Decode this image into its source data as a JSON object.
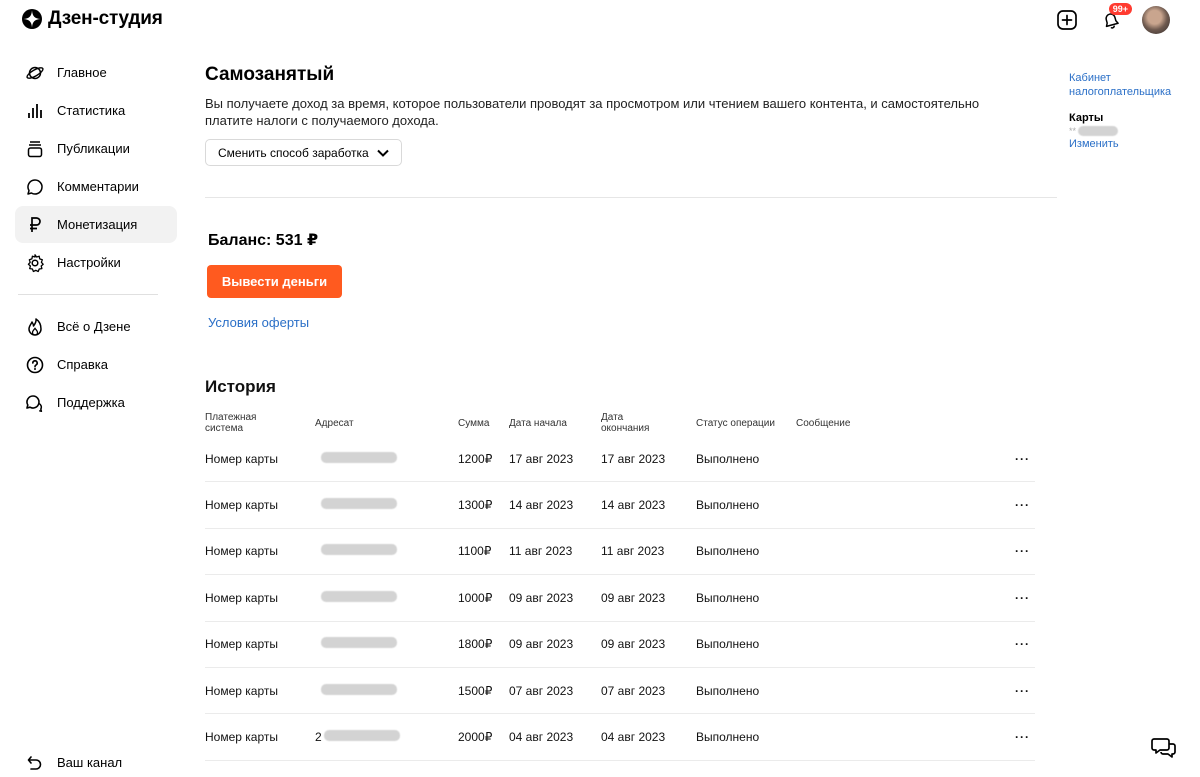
{
  "app": {
    "title": "Дзен-студия"
  },
  "header": {
    "notifications_badge": "99+"
  },
  "sidebar": {
    "items": [
      {
        "label": "Главное",
        "icon": "planet-icon"
      },
      {
        "label": "Статистика",
        "icon": "bar-chart-icon"
      },
      {
        "label": "Публикации",
        "icon": "publications-icon"
      },
      {
        "label": "Комментарии",
        "icon": "comment-icon"
      },
      {
        "label": "Монетизация",
        "icon": "ruble-icon",
        "active": true
      },
      {
        "label": "Настройки",
        "icon": "gear-icon"
      }
    ],
    "secondary": [
      {
        "label": "Всё о Дзене",
        "icon": "flame-icon"
      },
      {
        "label": "Справка",
        "icon": "help-icon"
      },
      {
        "label": "Поддержка",
        "icon": "support-icon"
      }
    ],
    "bottom": {
      "label": "Ваш канал",
      "icon": "back-arrow-icon"
    }
  },
  "main": {
    "title": "Самозанятый",
    "description": "Вы получаете доход за время, которое пользователи проводят за просмотром или чтением вашего контента, и самостоятельно платите налоги с получаемого дохода.",
    "switch_button": "Сменить способ заработка",
    "balance": "Баланс: 531 ₽",
    "withdraw_button": "Вывести деньги",
    "offer_link": "Условия оферты",
    "history_title": "История"
  },
  "table": {
    "columns": [
      "Платежная система",
      "Адресат",
      "Сумма",
      "Дата начала",
      "Дата окончания",
      "Статус операции",
      "Сообщение"
    ],
    "rows": [
      {
        "system": "Номер карты",
        "recipient_prefix": "",
        "amount": "1200₽",
        "start": "17 авг 2023",
        "end": "17 авг 2023",
        "status": "Выполнено"
      },
      {
        "system": "Номер карты",
        "recipient_prefix": "",
        "amount": "1300₽",
        "start": "14 авг 2023",
        "end": "14 авг 2023",
        "status": "Выполнено"
      },
      {
        "system": "Номер карты",
        "recipient_prefix": "",
        "amount": "1100₽",
        "start": "11 авг 2023",
        "end": "11 авг 2023",
        "status": "Выполнено"
      },
      {
        "system": "Номер карты",
        "recipient_prefix": "",
        "amount": "1000₽",
        "start": "09 авг 2023",
        "end": "09 авг 2023",
        "status": "Выполнено"
      },
      {
        "system": "Номер карты",
        "recipient_prefix": "",
        "amount": "1800₽",
        "start": "09 авг 2023",
        "end": "09 авг 2023",
        "status": "Выполнено"
      },
      {
        "system": "Номер карты",
        "recipient_prefix": "",
        "amount": "1500₽",
        "start": "07 авг 2023",
        "end": "07 авг 2023",
        "status": "Выполнено"
      },
      {
        "system": "Номер карты",
        "recipient_prefix": "2",
        "amount": "2000₽",
        "start": "04 авг 2023",
        "end": "04 авг 2023",
        "status": "Выполнено"
      }
    ],
    "row_menu": "···"
  },
  "right_panel": {
    "tax_cabinet_link": "Кабинет налогоплательщика",
    "cards_title": "Карты",
    "card_mask": "**",
    "change_link": "Изменить"
  },
  "colors": {
    "accent": "#ff5a1f",
    "link": "#2a6fc7",
    "active_bg": "#f2f2f2"
  }
}
